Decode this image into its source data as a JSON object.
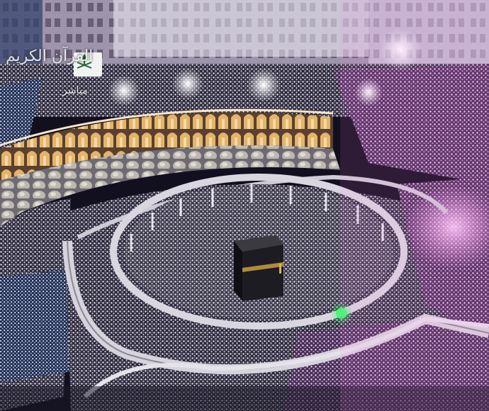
{
  "broadcast": {
    "logo_title": "القرآن الكريم",
    "live_label": "مباشر",
    "emblem": "saudi-emblem-icon"
  },
  "colors": {
    "crowd_white": "#e9e6f2",
    "crowd_purple": "#d8b4e6",
    "kaaba": "#1c1c22",
    "gallery_gold": "#c79a55",
    "marble": "#a9a7b4",
    "light_glow": "#ffffff"
  }
}
